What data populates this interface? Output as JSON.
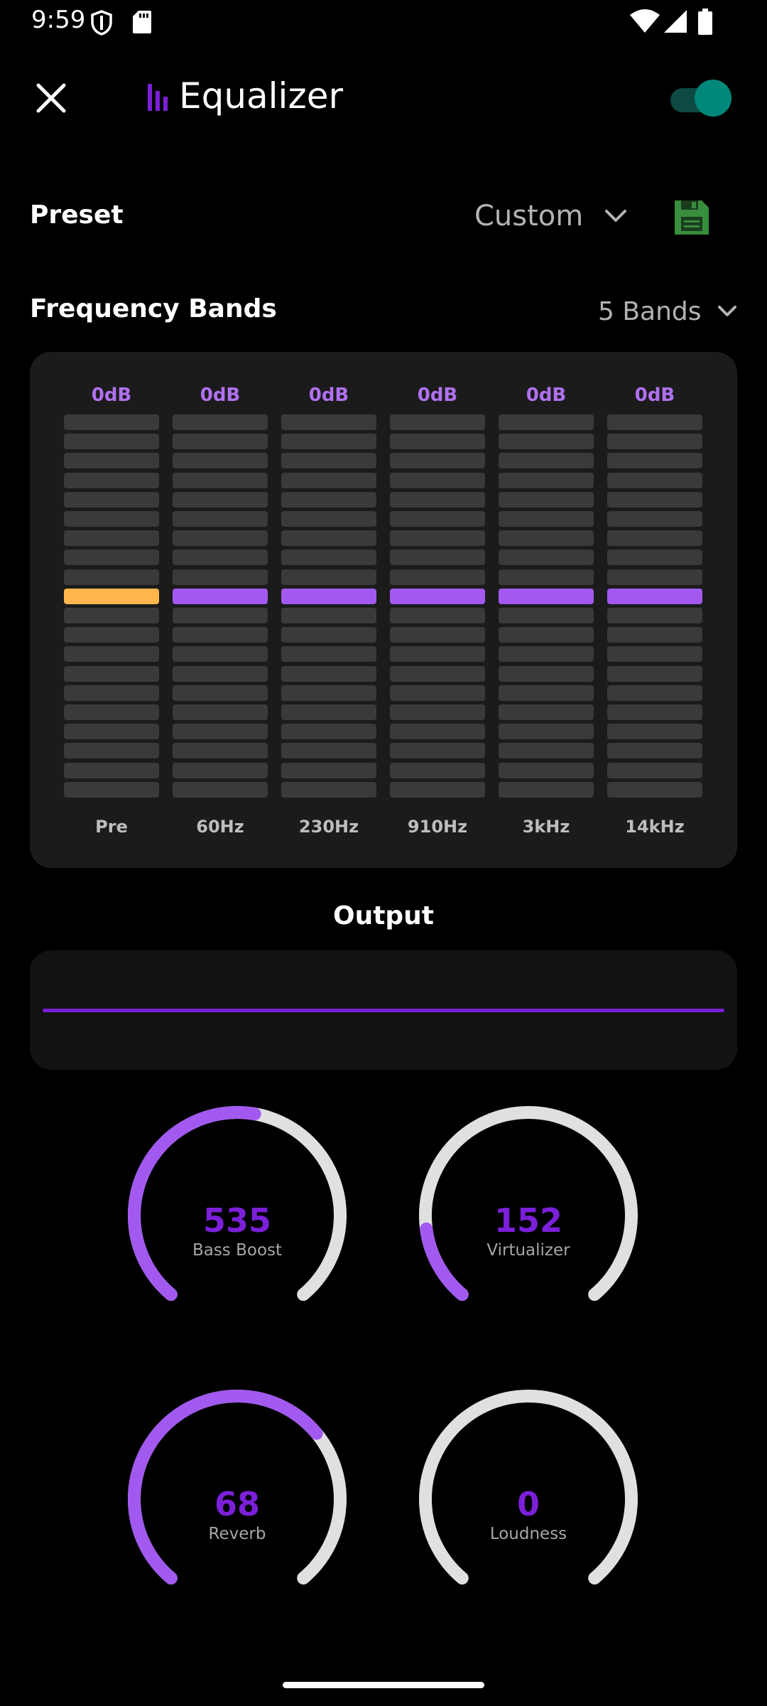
{
  "status_bar": {
    "time": "9:59",
    "icons": [
      "shield-icon",
      "sd-card-icon",
      "wifi-icon",
      "signal-icon",
      "battery-icon"
    ]
  },
  "header": {
    "title": "Equalizer",
    "title_icon": "equalizer-bars-icon",
    "close_icon": "close-icon",
    "enabled": true,
    "toggle_color": "#00897b"
  },
  "preset": {
    "label": "Preset",
    "value": "Custom",
    "save_icon": "save-icon",
    "save_color": "#388e3c"
  },
  "frequency_bands": {
    "label": "Frequency Bands",
    "value": "5 Bands",
    "segments_per_band": 20,
    "active_segment_index": 9,
    "bands": [
      {
        "name": "Pre",
        "db_label": "0dB",
        "level_db": 0,
        "color": "#ffb74d"
      },
      {
        "name": "60Hz",
        "db_label": "0dB",
        "level_db": 0,
        "color": "#a259f0"
      },
      {
        "name": "230Hz",
        "db_label": "0dB",
        "level_db": 0,
        "color": "#a259f0"
      },
      {
        "name": "910Hz",
        "db_label": "0dB",
        "level_db": 0,
        "color": "#a259f0"
      },
      {
        "name": "3kHz",
        "db_label": "0dB",
        "level_db": 0,
        "color": "#a259f0"
      },
      {
        "name": "14kHz",
        "db_label": "0dB",
        "level_db": 0,
        "color": "#a259f0"
      }
    ]
  },
  "output": {
    "title": "Output",
    "line_color": "#7b1fd8"
  },
  "knobs": [
    {
      "label": "Bass Boost",
      "value": "535",
      "level": 0.535
    },
    {
      "label": "Virtualizer",
      "value": "152",
      "level": 0.152
    },
    {
      "label": "Reverb",
      "value": "68",
      "level": 0.68
    },
    {
      "label": "Loudness",
      "value": "0",
      "level": 0
    }
  ],
  "colors": {
    "accent": "#a259f0",
    "knob_track": "#e0e0e0",
    "background": "#000000"
  }
}
